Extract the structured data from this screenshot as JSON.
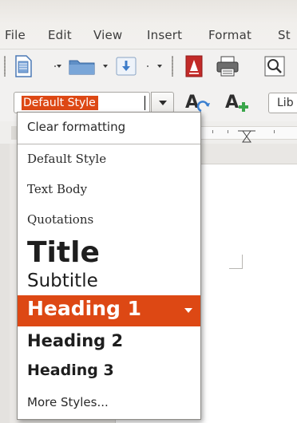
{
  "menubar": {
    "items": [
      "File",
      "Edit",
      "View",
      "Insert",
      "Format",
      "St"
    ]
  },
  "toolbar_standard": {
    "icons": [
      "new-document-icon",
      "open-folder-icon",
      "save-icon",
      "export-pdf-icon",
      "print-icon",
      "print-preview-icon"
    ]
  },
  "toolbar_formatting": {
    "paragraph_style_value": "Default Style",
    "font_name_value": "Lib",
    "icons": [
      "update-style-icon",
      "new-style-icon"
    ]
  },
  "style_dropdown": {
    "items": [
      {
        "label": "Clear formatting"
      },
      {
        "label": "Default Style"
      },
      {
        "label": "Text Body"
      },
      {
        "label": "Quotations"
      },
      {
        "label": "Title"
      },
      {
        "label": "Subtitle"
      },
      {
        "label": "Heading 1",
        "highlighted": true
      },
      {
        "label": "Heading 2"
      },
      {
        "label": "Heading 3"
      },
      {
        "label": "More Styles..."
      }
    ]
  },
  "colors": {
    "accent": "#dd4814",
    "menubar_bg": "#f2f1f0",
    "popup_bg": "#ffffff"
  }
}
